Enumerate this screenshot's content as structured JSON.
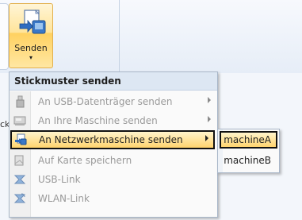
{
  "ribbon": {
    "send_button_label": "Senden",
    "send_button_dropdown_glyph": "▾",
    "send_icon": "send-to-machine-icon",
    "background_fragment": "ck"
  },
  "menu": {
    "header": "Stickmuster senden",
    "items": [
      {
        "label": "An USB-Datenträger senden",
        "icon": "usb-drive-icon",
        "enabled": false,
        "submenu": true
      },
      {
        "label": "An Ihre Maschine senden",
        "icon": "machine-icon",
        "enabled": false,
        "submenu": true
      },
      {
        "label": "An Netzwerkmaschine senden",
        "icon": "network-machine-icon",
        "enabled": true,
        "submenu": true,
        "highlighted": true
      },
      {
        "label": "Auf Karte speichern",
        "icon": "card-icon",
        "enabled": false,
        "submenu": false
      },
      {
        "label": "USB-Link",
        "icon": "usb-link-icon",
        "enabled": false,
        "submenu": false
      },
      {
        "label": "WLAN-Link",
        "icon": "wlan-link-icon",
        "enabled": false,
        "submenu": false
      }
    ]
  },
  "submenu": {
    "items": [
      {
        "label": "machineA",
        "highlighted": true
      },
      {
        "label": "machineB",
        "highlighted": false
      }
    ]
  },
  "colors": {
    "highlight_top": "#fff4cc",
    "highlight_bottom": "#ffd36e",
    "menu_header_bg": "#dde7f3",
    "disabled_text": "#9a9a9a"
  }
}
